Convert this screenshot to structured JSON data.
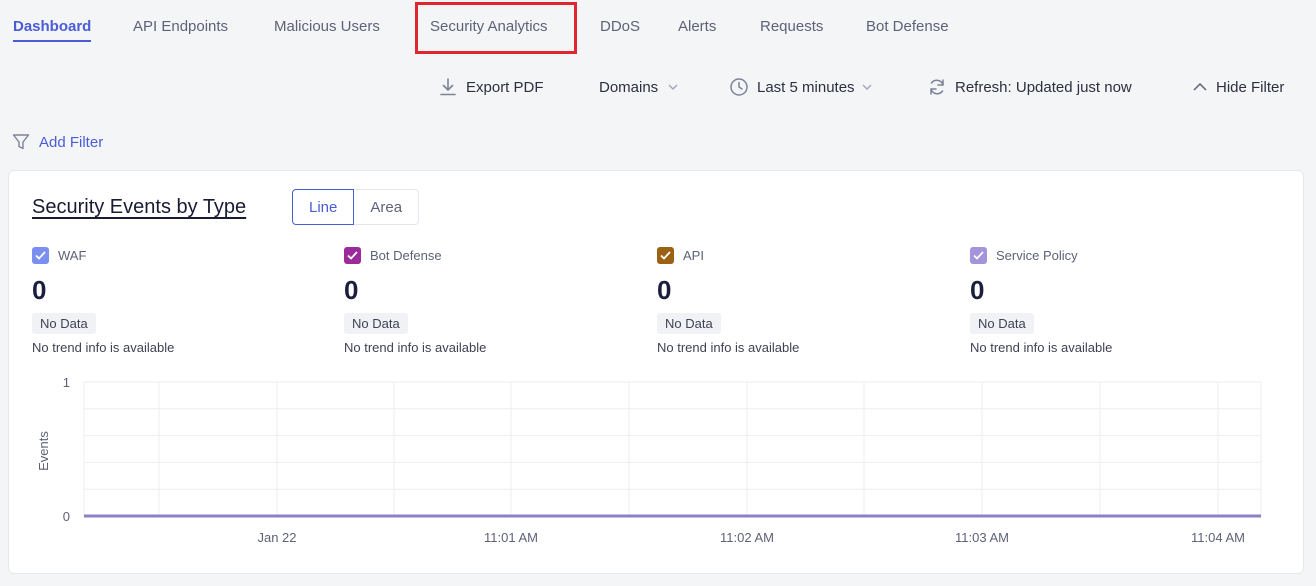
{
  "nav": {
    "tabs": [
      {
        "label": "Dashboard",
        "active": true
      },
      {
        "label": "API Endpoints",
        "active": false
      },
      {
        "label": "Malicious Users",
        "active": false
      },
      {
        "label": "Security Analytics",
        "active": false,
        "highlighted": true
      },
      {
        "label": "DDoS",
        "active": false
      },
      {
        "label": "Alerts",
        "active": false
      },
      {
        "label": "Requests",
        "active": false
      },
      {
        "label": "Bot Defense",
        "active": false
      }
    ]
  },
  "toolbar": {
    "export_label": "Export PDF",
    "domains_label": "Domains",
    "time_range_label": "Last 5 minutes",
    "refresh_label": "Refresh: Updated just now",
    "hide_filter_label": "Hide Filter"
  },
  "filter": {
    "add_label": "Add Filter"
  },
  "card": {
    "title": "Security Events by Type",
    "chart_mode": {
      "options": [
        "Line",
        "Area"
      ],
      "selected": "Line"
    },
    "metrics": [
      {
        "label": "WAF",
        "value": "0",
        "badge": "No Data",
        "trend": "No trend info is available",
        "color": "#7b8ff0"
      },
      {
        "label": "Bot Defense",
        "value": "0",
        "badge": "No Data",
        "trend": "No trend info is available",
        "color": "#9b2a9b"
      },
      {
        "label": "API",
        "value": "0",
        "badge": "No Data",
        "trend": "No trend info is available",
        "color": "#9a6212"
      },
      {
        "label": "Service Policy",
        "value": "0",
        "badge": "No Data",
        "trend": "No trend info is available",
        "color": "#a394dc"
      }
    ]
  },
  "colors": {
    "accent": "#4a5cd8",
    "highlight": "#e0252f",
    "series_line": "#8e7fc9"
  },
  "chart_data": {
    "type": "line",
    "ylabel": "Events",
    "xlabel": "",
    "ylim": [
      0,
      1
    ],
    "y_ticks": [
      "1",
      "0"
    ],
    "x_ticks": [
      "Jan 22",
      "11:01 AM",
      "11:02 AM",
      "11:03 AM",
      "11:04 AM"
    ],
    "grid": true,
    "series": [
      {
        "values": [
          0,
          0,
          0,
          0,
          0,
          0,
          0,
          0,
          0,
          0,
          0
        ]
      }
    ]
  }
}
